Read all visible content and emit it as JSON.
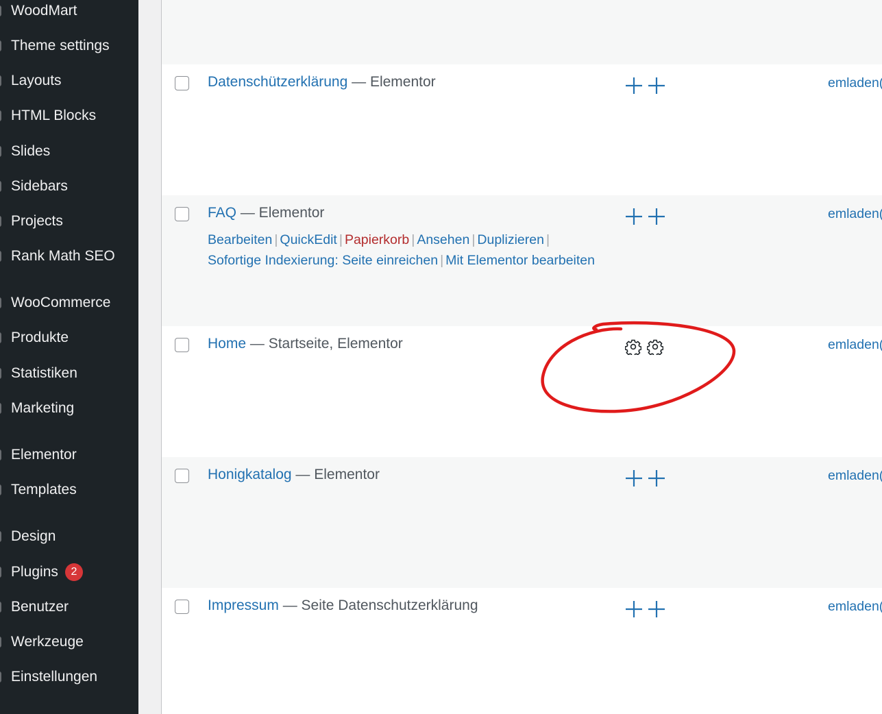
{
  "sidebar": {
    "items": [
      {
        "label": "WoodMart"
      },
      {
        "label": "Theme settings"
      },
      {
        "label": "Layouts"
      },
      {
        "label": "HTML Blocks"
      },
      {
        "label": "Slides"
      },
      {
        "label": "Sidebars"
      },
      {
        "label": "Projects"
      },
      {
        "label": "Rank Math SEO"
      },
      {
        "label": "WooCommerce"
      },
      {
        "label": "Produkte"
      },
      {
        "label": "Statistiken"
      },
      {
        "label": "Marketing"
      },
      {
        "label": "Elementor"
      },
      {
        "label": "Templates"
      },
      {
        "label": "Design"
      },
      {
        "label": "Plugins",
        "badge": "2"
      },
      {
        "label": "Benutzer"
      },
      {
        "label": "Werkzeuge"
      },
      {
        "label": "Einstellungen"
      }
    ]
  },
  "pages": {
    "rows": [
      {
        "title": "Datenschützerklärung",
        "state": " — Elementor",
        "icon": "plus-icon",
        "author": "emladen("
      },
      {
        "title": "FAQ",
        "state": " — Elementor",
        "icon": "plus-icon",
        "author": "emladen(",
        "actions": {
          "edit": "Bearbeiten",
          "quickedit": "QuickEdit",
          "trash": "Papierkorb",
          "view": "Ansehen",
          "duplicate": "Duplizieren",
          "index": "Sofortige Indexierung: Seite einreichen",
          "elementor": "Mit Elementor bearbeiten"
        }
      },
      {
        "title": "Home",
        "state": " — Startseite, Elementor",
        "icon": "gear-icon",
        "author": "emladen("
      },
      {
        "title": "Honigkatalog",
        "state": " — Elementor",
        "icon": "plus-icon",
        "author": "emladen("
      },
      {
        "title": "Impressum",
        "state": " — Seite Datenschutzerklärung",
        "icon": "plus-icon",
        "author": "emladen("
      }
    ]
  },
  "colors": {
    "sidebar_bg": "#1d2327",
    "link": "#2271b1",
    "trash": "#b32d2e",
    "badge": "#d63638",
    "annotation": "#e01b1b"
  }
}
